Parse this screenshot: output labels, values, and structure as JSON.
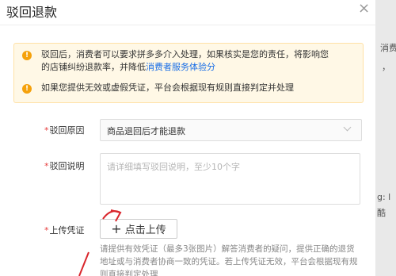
{
  "dialog": {
    "title": "驳回退款",
    "close_symbol": "×"
  },
  "notice": {
    "line1_part1": "驳回后，消费者可以要求拼多多介入处理，如果核实是您的责任，将影响您",
    "line1_part2": "的店铺纠纷退款率，并降低",
    "line1_link": "消费者服务体验分",
    "line2": "如果您提供无效或虚假凭证，平台会根据现有规则直接判定并处理"
  },
  "form": {
    "reason_label": "驳回原因",
    "reason_value": "商品退回后才能退款",
    "desc_label": "驳回说明",
    "desc_placeholder": "请详细填写驳回说明，至少10个字",
    "voucher_label": "上传凭证",
    "upload_label": "点击上传",
    "upload_hint": "请提供有效凭证（最多3张图片）解答消费者的疑问，提供正确的退货地址或与消费者协商一致的凭证。若上传凭证无效，平台会根据现有规则直接判定处理"
  },
  "background": {
    "text1": "消费",
    "text2": "，",
    "text3": "g: l",
    "text4": "酷"
  },
  "colors": {
    "warning": "#f5a10b",
    "link": "#1a6ee6",
    "required": "#e63b3b",
    "annotation": "#d9262c"
  }
}
